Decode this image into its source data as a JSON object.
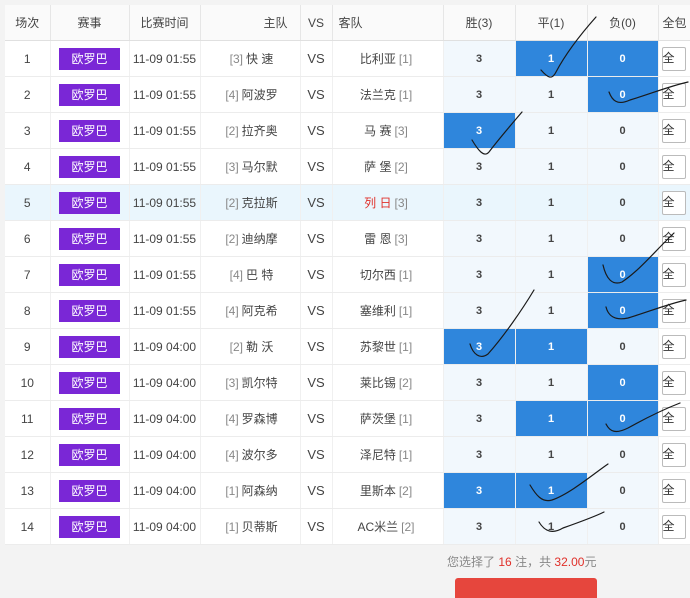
{
  "header": {
    "no": "场次",
    "league": "赛事",
    "time": "比赛时间",
    "home": "主队",
    "vs": "VS",
    "away": "客队",
    "win": "胜(3)",
    "draw": "平(1)",
    "lose": "负(0)",
    "all": "全包"
  },
  "matches": [
    {
      "no": "1",
      "league": "欧罗巴",
      "time": "11-09 01:55",
      "home_rank": "[3]",
      "home": "快 速",
      "vs": "VS",
      "away": "比利亚",
      "away_rank": "[1]",
      "win": "3",
      "draw": "1",
      "lose": "0",
      "all": "全"
    },
    {
      "no": "2",
      "league": "欧罗巴",
      "time": "11-09 01:55",
      "home_rank": "[4]",
      "home": "阿波罗",
      "vs": "VS",
      "away": "法兰克",
      "away_rank": "[1]",
      "win": "3",
      "draw": "1",
      "lose": "0",
      "all": "全"
    },
    {
      "no": "3",
      "league": "欧罗巴",
      "time": "11-09 01:55",
      "home_rank": "[2]",
      "home": "拉齐奥",
      "vs": "VS",
      "away": "马 赛",
      "away_rank": "[3]",
      "win": "3",
      "draw": "1",
      "lose": "0",
      "all": "全"
    },
    {
      "no": "4",
      "league": "欧罗巴",
      "time": "11-09 01:55",
      "home_rank": "[3]",
      "home": "马尔默",
      "vs": "VS",
      "away": "萨 堡",
      "away_rank": "[2]",
      "win": "3",
      "draw": "1",
      "lose": "0",
      "all": "全"
    },
    {
      "no": "5",
      "league": "欧罗巴",
      "time": "11-09 01:55",
      "home_rank": "[2]",
      "home": "克拉斯",
      "vs": "VS",
      "away": "列 日",
      "away_rank": "[3]",
      "win": "3",
      "draw": "1",
      "lose": "0",
      "all": "全"
    },
    {
      "no": "6",
      "league": "欧罗巴",
      "time": "11-09 01:55",
      "home_rank": "[2]",
      "home": "迪纳摩",
      "vs": "VS",
      "away": "雷 恩",
      "away_rank": "[3]",
      "win": "3",
      "draw": "1",
      "lose": "0",
      "all": "全"
    },
    {
      "no": "7",
      "league": "欧罗巴",
      "time": "11-09 01:55",
      "home_rank": "[4]",
      "home": "巴 特",
      "vs": "VS",
      "away": "切尔西",
      "away_rank": "[1]",
      "win": "3",
      "draw": "1",
      "lose": "0",
      "all": "全"
    },
    {
      "no": "8",
      "league": "欧罗巴",
      "time": "11-09 01:55",
      "home_rank": "[4]",
      "home": "阿克希",
      "vs": "VS",
      "away": "塞维利",
      "away_rank": "[1]",
      "win": "3",
      "draw": "1",
      "lose": "0",
      "all": "全"
    },
    {
      "no": "9",
      "league": "欧罗巴",
      "time": "11-09 04:00",
      "home_rank": "[2]",
      "home": "勒 沃",
      "vs": "VS",
      "away": "苏黎世",
      "away_rank": "[1]",
      "win": "3",
      "draw": "1",
      "lose": "0",
      "all": "全"
    },
    {
      "no": "10",
      "league": "欧罗巴",
      "time": "11-09 04:00",
      "home_rank": "[3]",
      "home": "凯尔特",
      "vs": "VS",
      "away": "莱比锡",
      "away_rank": "[2]",
      "win": "3",
      "draw": "1",
      "lose": "0",
      "all": "全"
    },
    {
      "no": "11",
      "league": "欧罗巴",
      "time": "11-09 04:00",
      "home_rank": "[4]",
      "home": "罗森博",
      "vs": "VS",
      "away": "萨茨堡",
      "away_rank": "[1]",
      "win": "3",
      "draw": "1",
      "lose": "0",
      "all": "全"
    },
    {
      "no": "12",
      "league": "欧罗巴",
      "time": "11-09 04:00",
      "home_rank": "[4]",
      "home": "波尔多",
      "vs": "VS",
      "away": "泽尼特",
      "away_rank": "[1]",
      "win": "3",
      "draw": "1",
      "lose": "0",
      "all": "全"
    },
    {
      "no": "13",
      "league": "欧罗巴",
      "time": "11-09 04:00",
      "home_rank": "[1]",
      "home": "阿森纳",
      "vs": "VS",
      "away": "里斯本",
      "away_rank": "[2]",
      "win": "3",
      "draw": "1",
      "lose": "0",
      "all": "全"
    },
    {
      "no": "14",
      "league": "欧罗巴",
      "time": "11-09 04:00",
      "home_rank": "[1]",
      "home": "贝蒂斯",
      "vs": "VS",
      "away": "AC米兰",
      "away_rank": "[2]",
      "win": "3",
      "draw": "1",
      "lose": "0",
      "all": "全"
    }
  ],
  "summary": {
    "prefix": "您选择了",
    "bets": "16",
    "mid": "注，共",
    "amount": "32.00",
    "suffix": "元"
  },
  "colors": {
    "league_bg": "#7a27d6",
    "selected": "#2f86dc",
    "option_bg": "#f2f8fd",
    "highlight_row": "#eaf6fd",
    "accent_red": "#e0302a",
    "submit": "#e6463d"
  }
}
